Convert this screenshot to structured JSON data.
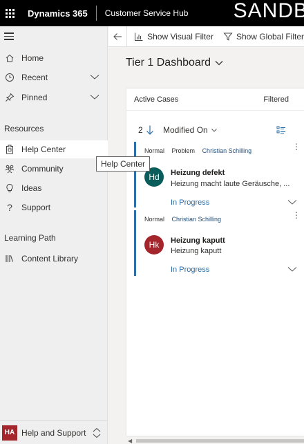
{
  "topbar": {
    "brand": "Dynamics 365",
    "app_name": "Customer Service Hub",
    "environment": "SANDB"
  },
  "sidebar": {
    "nav": [
      {
        "label": "Home",
        "icon": "home-icon"
      },
      {
        "label": "Recent",
        "icon": "clock-icon"
      },
      {
        "label": "Pinned",
        "icon": "pin-icon"
      }
    ],
    "resources_heading": "Resources",
    "resources": [
      {
        "label": "Help Center",
        "icon": "clipboard-icon"
      },
      {
        "label": "Community",
        "icon": "people-icon"
      },
      {
        "label": "Ideas",
        "icon": "lightbulb-icon"
      },
      {
        "label": "Support",
        "icon": "question-icon"
      }
    ],
    "learning_heading": "Learning Path",
    "learning": [
      {
        "label": "Content Library",
        "icon": "library-icon"
      }
    ],
    "area": {
      "badge": "HA",
      "name": "Help and Support",
      "badge_color": "#a4262c"
    }
  },
  "tooltip": {
    "text": "Help Center"
  },
  "commandbar": {
    "visual_filter": "Show Visual Filter",
    "global_filter": "Show Global Filter"
  },
  "dashboard": {
    "title": "Tier 1 Dashboard"
  },
  "stream": {
    "title": "Active Cases",
    "filtered": "Filtered",
    "count": "2",
    "sort_field": "Modified On",
    "items": [
      {
        "priority": "Normal",
        "type": "Problem",
        "owner": "Christian Schilling",
        "initials": "Hd",
        "avatar_color": "#0b5d5b",
        "title": "Heizung defekt",
        "description": "Heizung macht laute Geräusche, ...",
        "status": "In Progress"
      },
      {
        "priority": "Normal",
        "type": "",
        "owner": "Christian Schilling",
        "initials": "Hk",
        "avatar_color": "#a4262c",
        "title": "Heizung kaputt",
        "description": "Heizung kaputt",
        "status": "In Progress"
      }
    ]
  }
}
